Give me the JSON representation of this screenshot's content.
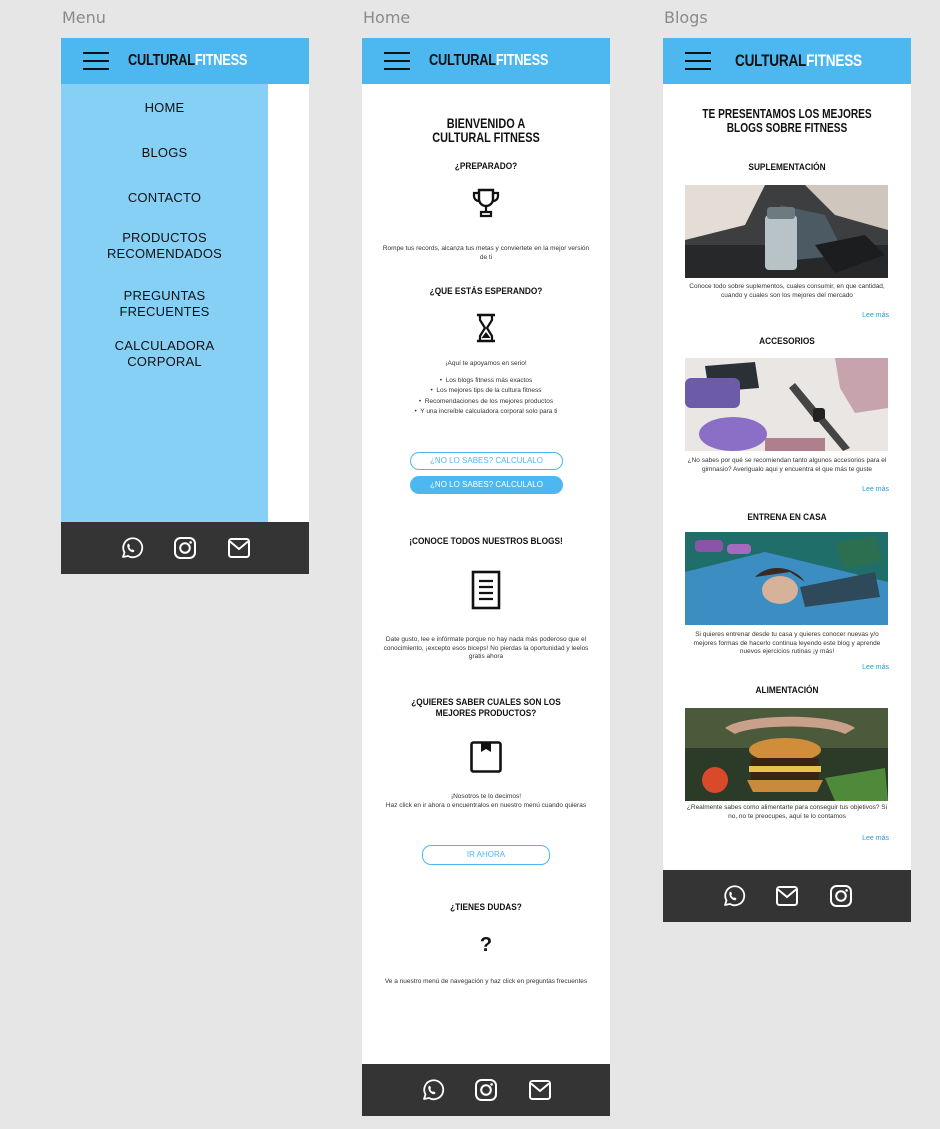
{
  "frames": {
    "menu": "Menu",
    "home": "Home",
    "blogs": "Blogs"
  },
  "logo": {
    "part1": "CULTURAL",
    "part2": "FITNESS"
  },
  "colors": {
    "accent": "#4db8f0",
    "menu_panel": "#86d0f6",
    "footer": "#343434",
    "link": "#2d9ad6"
  },
  "menu": {
    "items": [
      "HOME",
      "BLOGS",
      "CONTACTO",
      "PRODUCTOS\nRECOMENDADOS",
      "PREGUNTAS\nFRECUENTES",
      "CALCULADORA\nCORPORAL"
    ],
    "footer_icons": [
      "whatsapp-icon",
      "instagram-icon",
      "mail-icon"
    ]
  },
  "home": {
    "welcome": "BIENVENIDO A\nCULTURAL FITNESS",
    "s1_title": "¿PREPARADO?",
    "s1_text": "Rompe tus records, alcanza tus metas y conviertete en la mejor versión de ti",
    "s2_title": "¿QUE ESTÁS ESPERANDO?",
    "s2_text": "¡Aquí te apoyamos en serio!",
    "bullets": [
      "Los blogs fitness más exactos",
      "Los mejores tips de la cultura fitness",
      "Recomendaciones de los mejores productos",
      "Y una increíble calculadora corporal solo para ti"
    ],
    "btn_calc_outline": "¿NO LO SABES? CALCULALO",
    "btn_calc_filled": "¿NO LO SABES? CALCULALO",
    "s3_title": "¡CONOCE TODOS NUESTROS BLOGS!",
    "s3_text": "Date gusto, lee e infórmate porque no hay nada más poderoso que el conocimiento, ¡excepto esos biceps! No pierdas la oportunidad y leelos gratis ahora",
    "s4_title": "¿QUIERES SABER CUALES SON LOS\nMEJORES PRODUCTOS?",
    "s4_text": "¡Nosotros te lo decimos!\nHaz click en ir ahora o encuentralos en nuestro menú cuando quieras",
    "btn_go": "IR AHORA",
    "s5_title": "¿TIENES DUDAS?",
    "s5_icon": "?",
    "s5_text": "Ve a nuestro menú de navegación y haz click en preguntas frecuentes",
    "footer_icons": [
      "whatsapp-icon",
      "instagram-icon",
      "mail-icon"
    ]
  },
  "blogs": {
    "heading": "TE PRESENTAMOS LOS MEJORES\nBLOGS SOBRE FITNESS",
    "more_label": "Lee más",
    "items": [
      {
        "title": "SUPLEMENTACIÓN",
        "text": "Conoce todo sobre suplementos, cuales consumir, en que cantidad, cuando y cuales son los mejores del mercado"
      },
      {
        "title": "ACCESORIOS",
        "text": "¿No sabes por qué se recomiendan tanto algunos accesorios para el gimnasio? Averigualo aqui y encuentra el que más te guste"
      },
      {
        "title": "ENTRENA EN CASA",
        "text": "Si quieres entrenar desde tu casa y quieres conocer nuevas y/o mejores formas de hacerlo continua leyendo este blog y aprende nuevos ejercicios rutinas ¡y más!"
      },
      {
        "title": "ALIMENTACIÓN",
        "text": "¿Realmente sabes como alimentarte para conseguir tus objetivos? Si no, no te preocupes, aquí te lo contamos"
      }
    ],
    "footer_icons": [
      "whatsapp-icon",
      "mail-icon",
      "instagram-icon"
    ]
  }
}
